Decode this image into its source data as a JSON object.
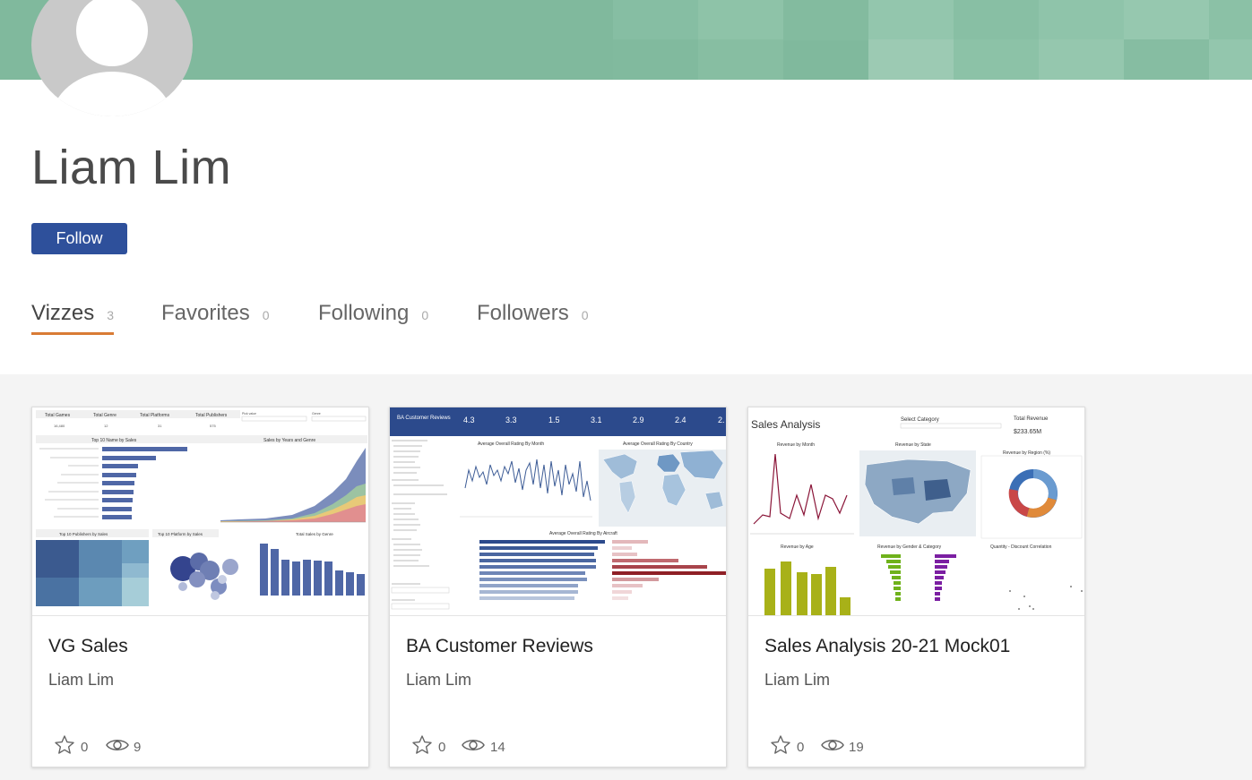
{
  "profile": {
    "name": "Liam Lim",
    "follow_label": "Follow"
  },
  "colors": {
    "banner": "#80b99d",
    "follow_button": "#2e509b",
    "active_tab_underline": "#d97b35"
  },
  "tabs": [
    {
      "label": "Vizzes",
      "count": "3"
    },
    {
      "label": "Favorites",
      "count": "0"
    },
    {
      "label": "Following",
      "count": "0"
    },
    {
      "label": "Followers",
      "count": "0"
    }
  ],
  "cards": [
    {
      "title": "VG Sales",
      "author": "Liam Lim",
      "favorites": "0",
      "views": "9",
      "thumb": {
        "headers": [
          "Total Games",
          "Total Genre",
          "Total Platforms",
          "Total Publishers"
        ],
        "kpis": [
          "16,480",
          "12",
          "31",
          "575"
        ],
        "filter_labels": [
          "Pick value",
          "Genre"
        ],
        "chart_titles": [
          "Top 10 Name by Sales",
          "Sales by Years and Genre",
          "Top 10 Publishers by Sales",
          "Top 10 Platform by Sales",
          "Total Sales by Genre"
        ]
      }
    },
    {
      "title": "BA Customer Reviews",
      "author": "Liam Lim",
      "favorites": "0",
      "views": "14",
      "thumb": {
        "header_title": "BA Customer Reviews",
        "kpis": [
          "4.3",
          "3.3",
          "1.5",
          "3.1",
          "2.9",
          "2.4",
          "2."
        ],
        "chart_titles": [
          "Average Overall Rating By Month",
          "Average Overall Rating By Country",
          "Average Overall Rating By Aircraft"
        ]
      }
    },
    {
      "title": "Sales Analysis 20-21 Mock01",
      "author": "Liam Lim",
      "favorites": "0",
      "views": "19",
      "thumb": {
        "header_title": "Sales Analysis",
        "filter_label": "Select Category",
        "revenue_label": "Total Revenue",
        "revenue_value": "$233.65M",
        "chart_titles": [
          "Revenue by Month",
          "Revenue by State",
          "Revenue by Region (%)",
          "Revenue by Age",
          "Revenue by Gender & Category",
          "Quantity - Discount Correlation"
        ]
      }
    }
  ]
}
